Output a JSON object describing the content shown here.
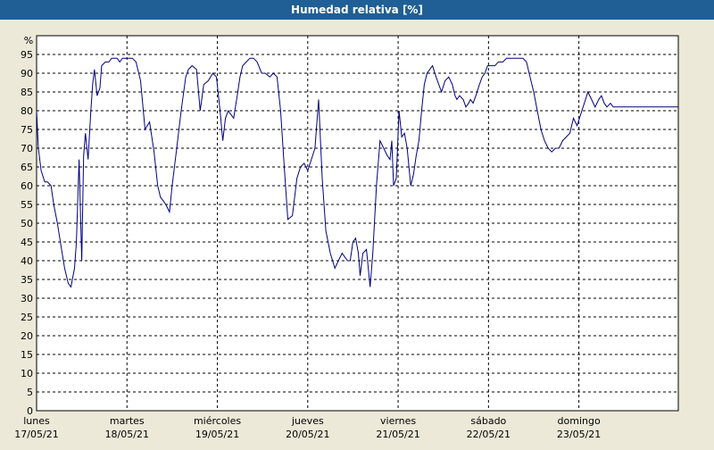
{
  "window": {
    "title": "Humedad relativa [%]"
  },
  "colors": {
    "background": "#ece9d8",
    "plot_area": "#ffffff",
    "title_bar": "#1f5f95",
    "line": "#000080",
    "grid": "#000000"
  },
  "chart_data": {
    "type": "line",
    "title": "Humedad relativa [%]",
    "ylabel": "%",
    "xlabel": "",
    "ylim": [
      0,
      100
    ],
    "xlim": [
      0,
      7.1
    ],
    "yticks": [
      0,
      5,
      10,
      15,
      20,
      25,
      30,
      35,
      40,
      45,
      50,
      55,
      60,
      65,
      70,
      75,
      80,
      85,
      90,
      95
    ],
    "grid": true,
    "legend": "none",
    "x_unit": "days from lunes 17/05/21 00:00",
    "day_labels": [
      {
        "x": 0,
        "day": "lunes",
        "date": "17/05/21"
      },
      {
        "x": 1,
        "day": "martes",
        "date": "18/05/21"
      },
      {
        "x": 2,
        "day": "miércoles",
        "date": "19/05/21"
      },
      {
        "x": 3,
        "day": "jueves",
        "date": "20/05/21"
      },
      {
        "x": 4,
        "day": "viernes",
        "date": "21/05/21"
      },
      {
        "x": 5,
        "day": "sábado",
        "date": "22/05/21"
      },
      {
        "x": 6,
        "day": "domingo",
        "date": "23/05/21"
      }
    ],
    "series": [
      {
        "color": "#000080",
        "x": [
          0.0,
          0.02,
          0.05,
          0.09,
          0.12,
          0.16,
          0.19,
          0.23,
          0.27,
          0.31,
          0.35,
          0.38,
          0.42,
          0.44,
          0.47,
          0.5,
          0.52,
          0.54,
          0.57,
          0.6,
          0.62,
          0.64,
          0.67,
          0.7,
          0.72,
          0.76,
          0.8,
          0.83,
          0.86,
          0.89,
          0.92,
          0.95,
          0.98,
          1.02,
          1.06,
          1.1,
          1.15,
          1.2,
          1.25,
          1.3,
          1.34,
          1.37,
          1.4,
          1.43,
          1.47,
          1.5,
          1.55,
          1.6,
          1.65,
          1.68,
          1.72,
          1.77,
          1.81,
          1.85,
          1.9,
          1.95,
          1.99,
          2.03,
          2.06,
          2.09,
          2.12,
          2.15,
          2.18,
          2.22,
          2.25,
          2.28,
          2.32,
          2.36,
          2.4,
          2.44,
          2.49,
          2.53,
          2.58,
          2.62,
          2.66,
          2.7,
          2.74,
          2.78,
          2.83,
          2.88,
          2.92,
          2.96,
          3.0,
          3.04,
          3.08,
          3.12,
          3.16,
          3.2,
          3.25,
          3.3,
          3.34,
          3.38,
          3.41,
          3.44,
          3.47,
          3.5,
          3.53,
          3.56,
          3.58,
          3.61,
          3.65,
          3.69,
          3.72,
          3.76,
          3.8,
          3.84,
          3.88,
          3.91,
          3.93,
          3.95,
          3.98,
          4.01,
          4.04,
          4.07,
          4.1,
          4.14,
          4.17,
          4.2,
          4.23,
          4.26,
          4.29,
          4.32,
          4.35,
          4.38,
          4.42,
          4.45,
          4.48,
          4.52,
          4.56,
          4.6,
          4.63,
          4.65,
          4.68,
          4.72,
          4.75,
          4.78,
          4.8,
          4.83,
          4.86,
          4.9,
          4.93,
          4.96,
          4.99,
          5.03,
          5.07,
          5.11,
          5.16,
          5.2,
          5.25,
          5.3,
          5.34,
          5.38,
          5.42,
          5.45,
          5.5,
          5.54,
          5.58,
          5.62,
          5.66,
          5.7,
          5.74,
          5.78,
          5.82,
          5.86,
          5.9,
          5.94,
          5.98,
          6.02,
          6.06,
          6.1,
          6.14,
          6.18,
          6.22,
          6.25,
          6.28,
          6.31,
          6.35,
          6.38,
          6.42,
          6.46,
          6.5,
          6.53,
          6.56,
          6.6,
          6.63,
          6.66,
          6.7,
          6.74,
          6.78,
          6.83,
          6.87,
          6.92,
          6.96,
          7.0,
          7.05,
          7.09,
          7.1
        ],
        "values": [
          80,
          70,
          64,
          61,
          61,
          60,
          55,
          50,
          44,
          38,
          34,
          33,
          38,
          45,
          67,
          40,
          68,
          74,
          67,
          80,
          87,
          91,
          84,
          86,
          92,
          93,
          93,
          94,
          94,
          94,
          93,
          94,
          94,
          94,
          94,
          93,
          88,
          75,
          77,
          69,
          60,
          57,
          56,
          55,
          53,
          60,
          70,
          80,
          89,
          91,
          92,
          91,
          80,
          87,
          88,
          90,
          89,
          80,
          72,
          78,
          80,
          79,
          78,
          84,
          89,
          92,
          93,
          94,
          94,
          93,
          90,
          90,
          89,
          90,
          89,
          80,
          65,
          51,
          52,
          62,
          65,
          66,
          64,
          67,
          70,
          83,
          62,
          48,
          42,
          38,
          40,
          42,
          41,
          40,
          40,
          45,
          46,
          42,
          36,
          42,
          43,
          33,
          42,
          60,
          72,
          70,
          68,
          67,
          72,
          60,
          62,
          80,
          73,
          74,
          70,
          60,
          63,
          68,
          72,
          80,
          87,
          90,
          91,
          92,
          89,
          87,
          85,
          88,
          89,
          87,
          84,
          83,
          84,
          83,
          81,
          82,
          83,
          82,
          84,
          87,
          89,
          90,
          92,
          92,
          92,
          93,
          93,
          94,
          94,
          94,
          94,
          94,
          93,
          90,
          85,
          80,
          75,
          72,
          70,
          69,
          70,
          70,
          72,
          73,
          74,
          78,
          76,
          79,
          82,
          85,
          83,
          81,
          83,
          84,
          82,
          81,
          82,
          81,
          81,
          81,
          81,
          81,
          81,
          81,
          81,
          81,
          81,
          81,
          81,
          81,
          81,
          81,
          81,
          81,
          81,
          81,
          81
        ]
      }
    ]
  }
}
